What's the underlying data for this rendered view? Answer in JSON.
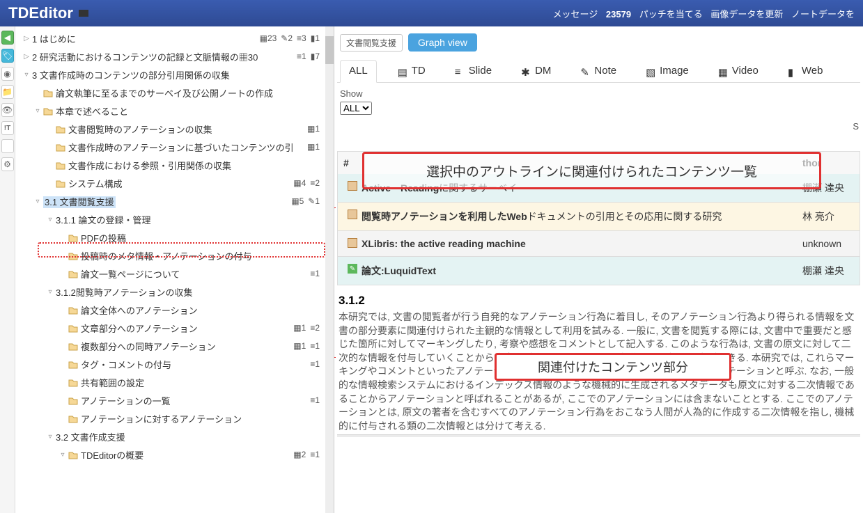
{
  "header": {
    "title": "TDEditor",
    "msg_label": "メッセージ",
    "msg_count": "23579",
    "patch": "パッチを当てる",
    "img_update": "画像データを更新",
    "note_update": "ノートデータを"
  },
  "tree": [
    {
      "ind": 1,
      "exp": "▷",
      "lbl": "1 はじめに",
      "m": [
        "▦23",
        "✎2",
        "≡3",
        "▮1"
      ]
    },
    {
      "ind": 1,
      "exp": "▷",
      "lbl": "2 研究活動におけるコンテンツの記録と文脈情報の▦30",
      "m": [
        "≡1",
        "▮7"
      ]
    },
    {
      "ind": 1,
      "exp": "▿",
      "lbl": "3 文書作成時のコンテンツの部分引用関係の収集",
      "m": []
    },
    {
      "ind": 2,
      "exp": "",
      "fld": true,
      "lbl": "論文執筆に至るまでのサーベイ及び公開ノートの作成",
      "m": []
    },
    {
      "ind": 2,
      "exp": "▿",
      "fld": true,
      "lbl": "本章で述べること",
      "m": []
    },
    {
      "ind": 3,
      "exp": "",
      "fld": true,
      "lbl": "文書閲覧時のアノテーションの収集",
      "m": [
        "▦1"
      ]
    },
    {
      "ind": 3,
      "exp": "",
      "fld": true,
      "lbl": "文書作成時のアノテーションに基づいたコンテンツの引",
      "m": [
        "▦1"
      ]
    },
    {
      "ind": 3,
      "exp": "",
      "fld": true,
      "lbl": "文書作成における参照・引用関係の収集",
      "m": []
    },
    {
      "ind": 3,
      "exp": "",
      "fld": true,
      "lbl": "システム構成",
      "m": [
        "▦4",
        "≡2"
      ]
    },
    {
      "ind": 2,
      "exp": "▿",
      "sel": true,
      "lbl": "3.1 文書閲覧支援",
      "m": [
        "▦5",
        "✎1"
      ]
    },
    {
      "ind": 3,
      "exp": "▿",
      "lbl": "3.1.1 論文の登録・管理",
      "m": []
    },
    {
      "ind": 4,
      "exp": "",
      "fld": true,
      "lbl": "PDFの投稿",
      "m": []
    },
    {
      "ind": 4,
      "exp": "",
      "fld": true,
      "lbl": "投稿時のメタ情報・アノテーションの付与",
      "m": []
    },
    {
      "ind": 4,
      "exp": "",
      "fld": true,
      "lbl": "論文一覧ページについて",
      "m": [
        "≡1"
      ]
    },
    {
      "ind": 3,
      "exp": "▿",
      "lbl": "3.1.2閲覧時アノテーションの収集",
      "m": []
    },
    {
      "ind": 4,
      "exp": "",
      "fld": true,
      "lbl": "論文全体へのアノテーション",
      "m": []
    },
    {
      "ind": 4,
      "exp": "",
      "fld": true,
      "lbl": "文章部分へのアノテーション",
      "m": [
        "▦1",
        "≡2"
      ]
    },
    {
      "ind": 4,
      "exp": "",
      "fld": true,
      "lbl": "複数部分への同時アノテーション",
      "m": [
        "▦1",
        "≡1"
      ]
    },
    {
      "ind": 4,
      "exp": "",
      "fld": true,
      "lbl": "タグ・コメントの付与",
      "m": [
        "≡1"
      ]
    },
    {
      "ind": 4,
      "exp": "",
      "fld": true,
      "lbl": "共有範囲の設定",
      "m": []
    },
    {
      "ind": 4,
      "exp": "",
      "fld": true,
      "lbl": "アノテーションの一覧",
      "m": [
        "≡1"
      ]
    },
    {
      "ind": 4,
      "exp": "",
      "fld": true,
      "lbl": "アノテーションに対するアノテーション",
      "m": []
    },
    {
      "ind": 3,
      "exp": "▿",
      "lbl": "3.2 文書作成支援",
      "m": []
    },
    {
      "ind": 4,
      "exp": "▿",
      "fld": true,
      "lbl": "TDEditorの概要",
      "m": [
        "▦2",
        "≡1"
      ]
    }
  ],
  "crumb": "文書閲覧支援",
  "graph_btn": "Graph view",
  "tabs": {
    "all": "ALL",
    "td": "TD",
    "slide": "Slide",
    "dm": "DM",
    "note": "Note",
    "image": "Image",
    "video": "Video",
    "web": "Web"
  },
  "show_label": "Show",
  "show_value": "ALL",
  "s_label": "S",
  "table": {
    "head_hash": "#",
    "head_author": "thor",
    "rows": [
      {
        "cls": "t-teal",
        "title_pre": "Active　Reading",
        "title_post": "に関するサーベイ",
        "author": "棚瀬 達央"
      },
      {
        "cls": "t-yellow",
        "title_pre": "閲覧時アノテーションを利用した",
        "title_mid": "Web",
        "title_post": "ドキュメントの引用とその応用に関する研究",
        "author": "林 亮介"
      },
      {
        "cls": "t-gray",
        "title_pre": "XLibris: the active reading machine",
        "title_post": "",
        "author": "unknown"
      },
      {
        "cls": "t-teal",
        "green": true,
        "title_pre": "論文:LuquidText",
        "title_post": "",
        "author": "棚瀬 達央"
      }
    ]
  },
  "callout1": "選択中のアウトラインに関連付けられたコンテンツ一覧",
  "callout2": "関連付けたコンテンツ部分",
  "section_num": "3.1.2",
  "body": "本研究では, 文書の閲覧者が行う自発的なアノテーション行為に着目し, そのアノテーション行為より得られる情報を文書の部分要素に関連付けられた主観的な情報として利用を試みる. 一般に, 文書を閲覧する際には, 文書中で重要だと感じた箇所に対してマーキングしたり, 考察や感想をコメントとして記入する. このような行為は, 文書の原文に対して二次的な情報を付与していくことから文書に対するアノテーション行為として捉える事ができる. 本研究では, これらマーキングやコメントといったアノテーションは文書閲覧時に付与されることから閲覧時アノテーションと呼ぶ. なお, 一般的な情報検索システムにおけるインデックス情報のような機械的に生成されるメタデータも原文に対する二次情報であることからアノテーションと呼ばれることがあるが, ここでのアノテーションには含まないこととする. ここでのアノテーションとは, 原文の著者を含むすべてのアノテーション行為をおこなう人間が人為的に作成する二次情報を指し, 機械的に付与される類の二次情報とは分けて考える."
}
